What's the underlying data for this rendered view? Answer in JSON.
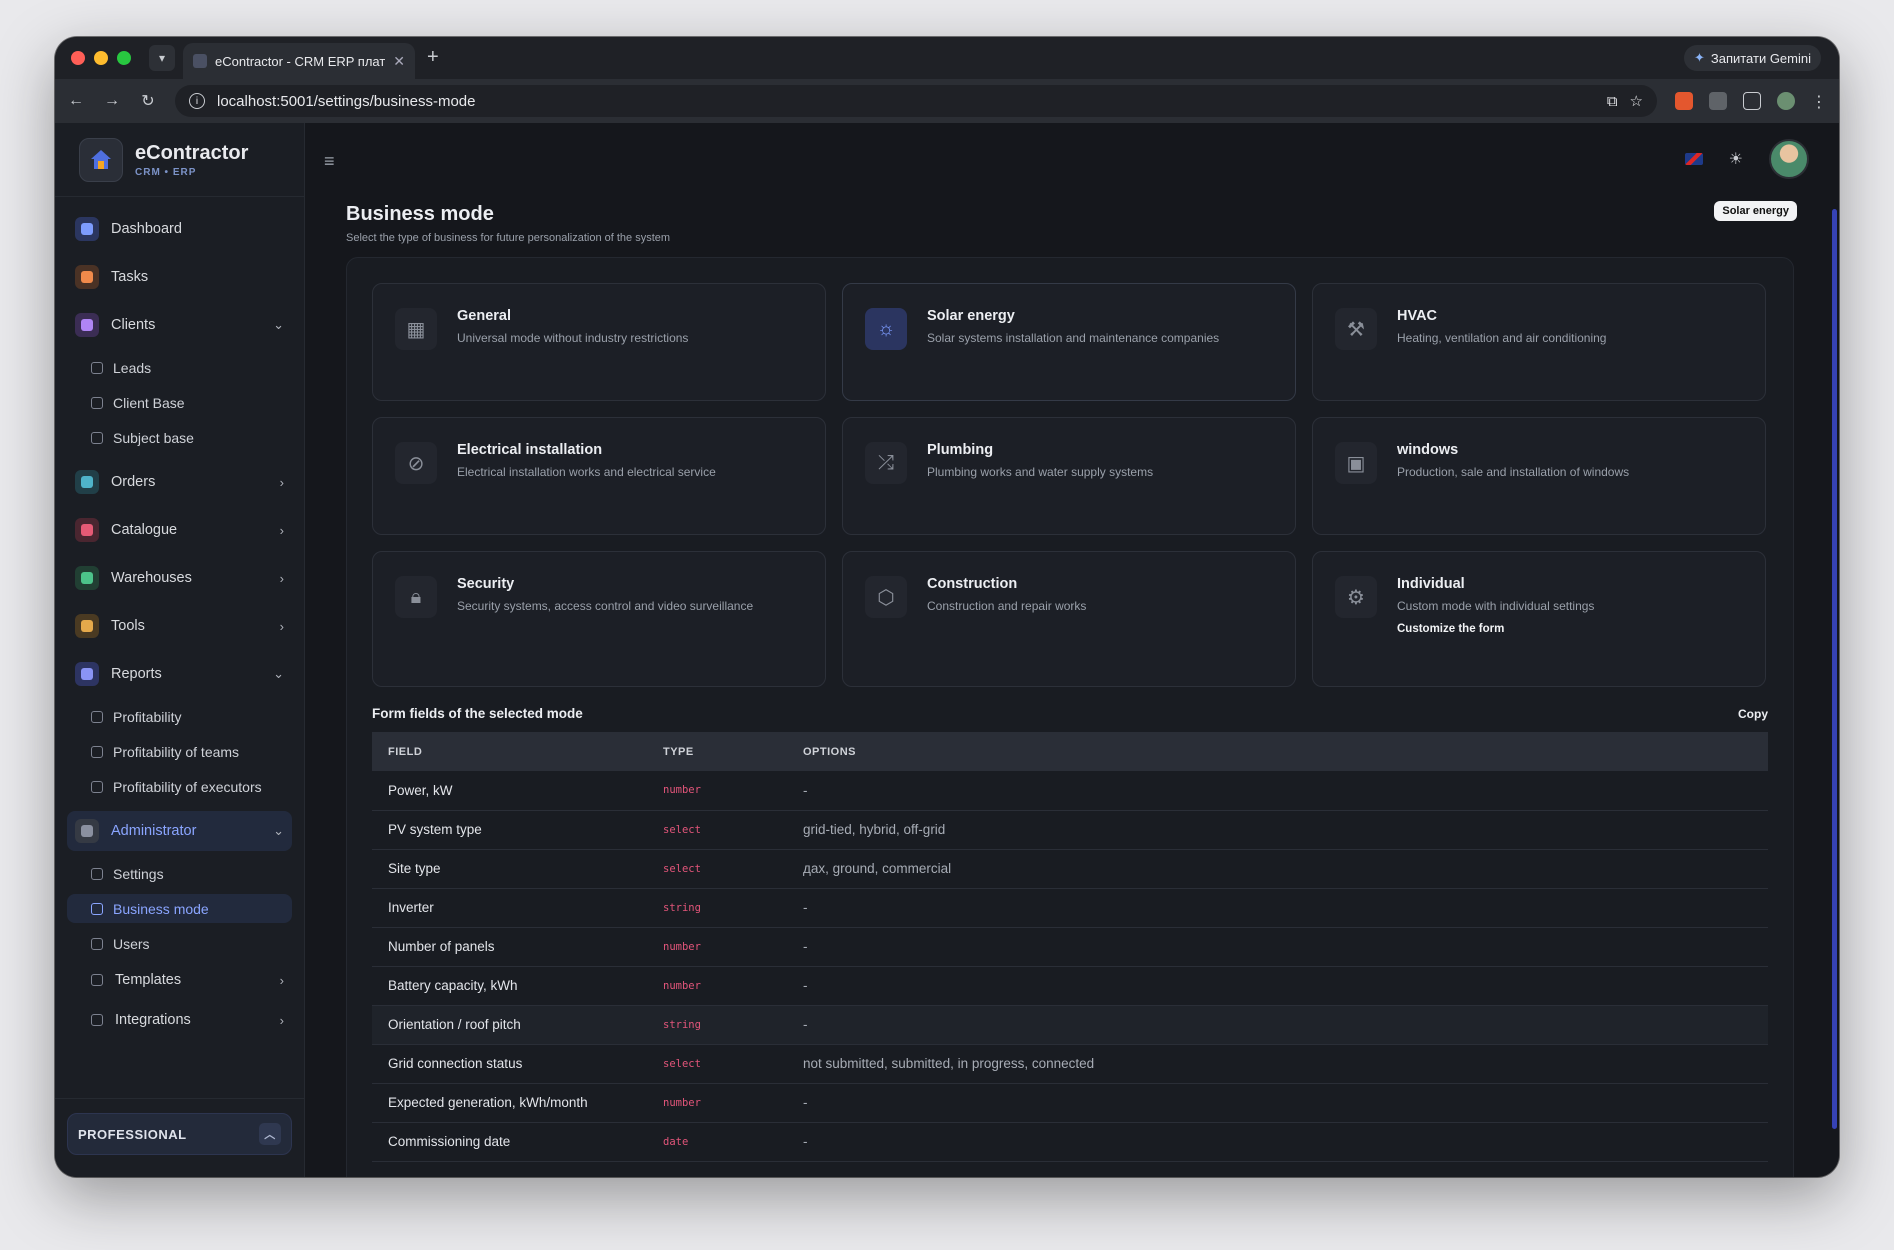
{
  "browser": {
    "tab_title": "eContractor - CRM ERP плат",
    "url": "localhost:5001/settings/business-mode",
    "gemini_label": "Запитати Gemini"
  },
  "brand": {
    "name": "eContractor",
    "sub": "CRM • ERP"
  },
  "sidebar": {
    "items": [
      {
        "label": "Dashboard"
      },
      {
        "label": "Tasks"
      },
      {
        "label": "Clients"
      },
      {
        "label": "Leads"
      },
      {
        "label": "Client Base"
      },
      {
        "label": "Subject base"
      },
      {
        "label": "Orders"
      },
      {
        "label": "Catalogue"
      },
      {
        "label": "Warehouses"
      },
      {
        "label": "Tools"
      },
      {
        "label": "Reports"
      },
      {
        "label": "Profitability"
      },
      {
        "label": "Profitability of teams"
      },
      {
        "label": "Profitability of executors"
      },
      {
        "label": "Administrator"
      },
      {
        "label": "Settings"
      },
      {
        "label": "Business mode"
      },
      {
        "label": "Users"
      },
      {
        "label": "Templates"
      },
      {
        "label": "Integrations"
      }
    ],
    "plan": "PROFESSIONAL"
  },
  "header": {
    "title": "Business mode",
    "subtitle": "Select the type of business for future personalization of the system",
    "selected_badge": "Solar energy"
  },
  "modes": [
    {
      "title": "General",
      "desc": "Universal mode without industry restrictions",
      "icon": "grid-icon"
    },
    {
      "title": "Solar energy",
      "desc": "Solar systems installation and maintenance companies",
      "icon": "sun-icon"
    },
    {
      "title": "HVAC",
      "desc": "Heating, ventilation and air conditioning",
      "icon": "wrench-icon"
    },
    {
      "title": "Electrical installation",
      "desc": "Electrical installation works and electrical service",
      "icon": "eye-off-icon"
    },
    {
      "title": "Plumbing",
      "desc": "Plumbing works and water supply systems",
      "icon": "shuffle-icon"
    },
    {
      "title": "windows",
      "desc": "Production, sale and installation of windows",
      "icon": "image-icon"
    },
    {
      "title": "Security",
      "desc": "Security systems, access control and video surveillance",
      "icon": "lock-icon"
    },
    {
      "title": "Construction",
      "desc": "Construction and repair works",
      "icon": "box-icon"
    },
    {
      "title": "Individual",
      "desc": "Custom mode with individual settings",
      "icon": "gear-icon",
      "link": "Customize the form"
    }
  ],
  "fields": {
    "title": "Form fields of the selected mode",
    "copy_label": "Copy",
    "columns": [
      "FIELD",
      "TYPE",
      "OPTIONS"
    ],
    "rows": [
      {
        "field": "Power, kW",
        "type": "number",
        "options": "-"
      },
      {
        "field": "PV system type",
        "type": "select",
        "options": "grid-tied, hybrid, off-grid"
      },
      {
        "field": "Site type",
        "type": "select",
        "options": "дах, ground, commercial"
      },
      {
        "field": "Inverter",
        "type": "string",
        "options": "-"
      },
      {
        "field": "Number of panels",
        "type": "number",
        "options": "-"
      },
      {
        "field": "Battery capacity, kWh",
        "type": "number",
        "options": "-"
      },
      {
        "field": "Orientation / roof pitch",
        "type": "string",
        "options": "-"
      },
      {
        "field": "Grid connection status",
        "type": "select",
        "options": "not submitted, submitted, in progress, connected"
      },
      {
        "field": "Expected generation, kWh/month",
        "type": "number",
        "options": "-"
      },
      {
        "field": "Commissioning date",
        "type": "date",
        "options": "-"
      }
    ]
  }
}
